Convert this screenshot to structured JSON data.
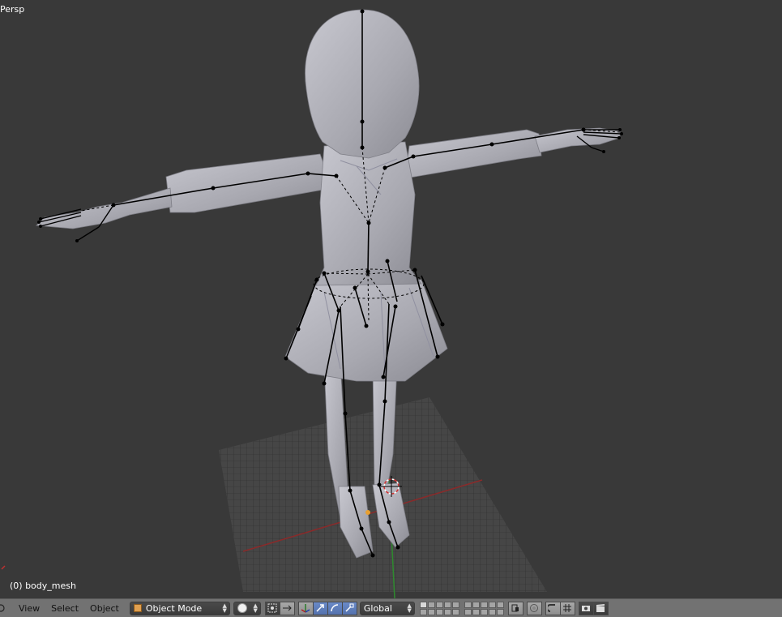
{
  "viewport": {
    "view_name": "Persp",
    "object_info": "(0) body_mesh"
  },
  "header": {
    "menu": [
      "View",
      "Select",
      "Object"
    ],
    "mode": "Object Mode",
    "orientation": "Global"
  },
  "icons": {
    "editor_type": "editor-type-icon",
    "mode": "cube-icon",
    "shading": "sphere-icon",
    "pivot": "pivot-icon",
    "manipulator": "manipulator-icon",
    "translate": "translate-arrow-icon",
    "rotate": "rotate-icon",
    "scale": "scale-icon",
    "render": "camera-icon",
    "animation": "clapperboard-icon"
  },
  "colors": {
    "background": "#393939",
    "header": "#727272",
    "mesh": "#b4b4bc",
    "bone": "#000000",
    "x_axis": "#8a2a2a",
    "y_axis": "#2e8a2e"
  }
}
